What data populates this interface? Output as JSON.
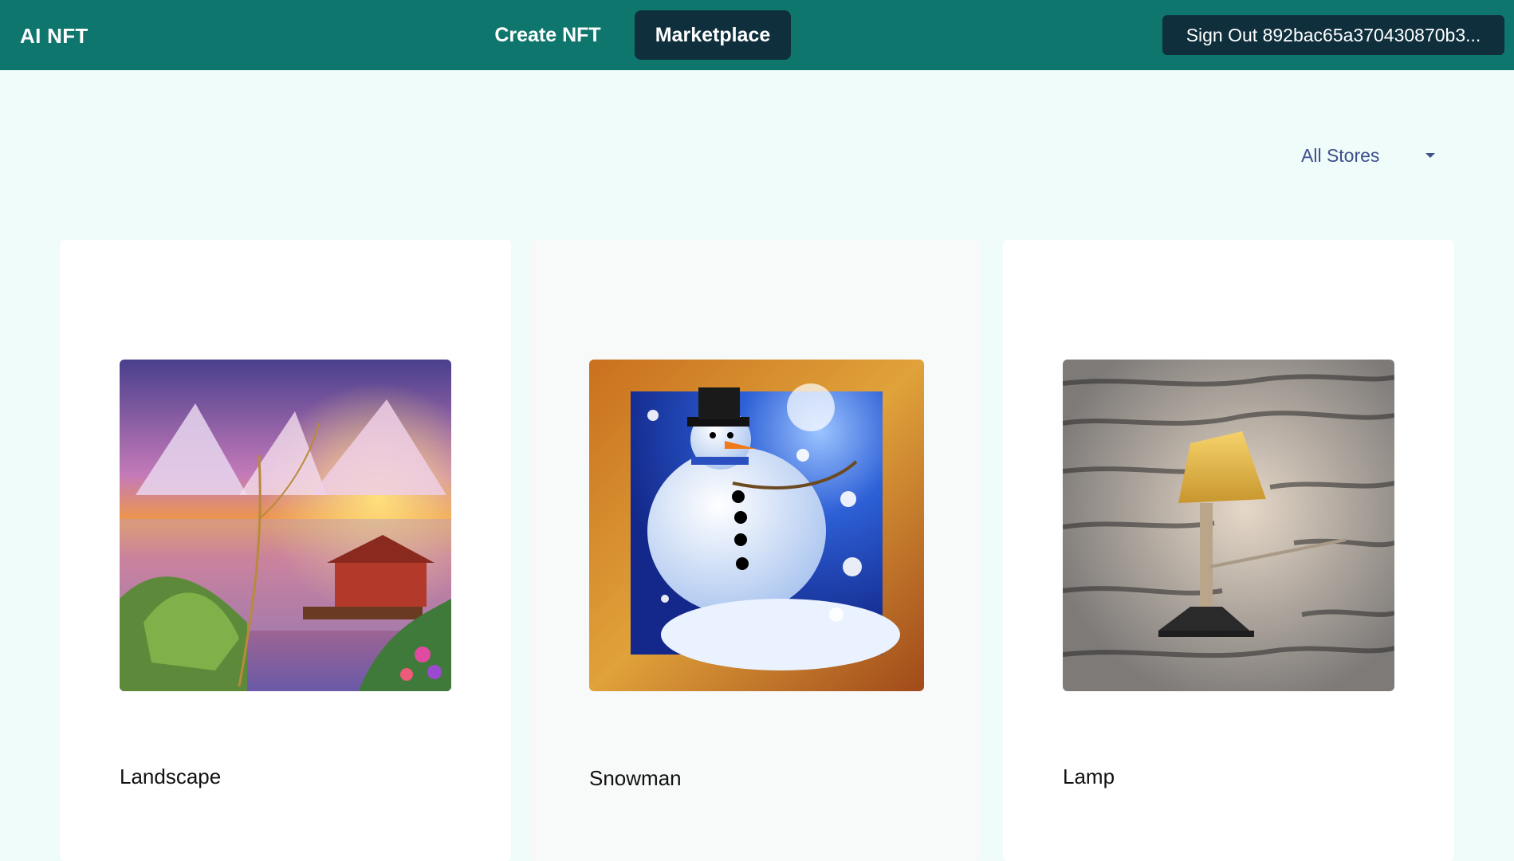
{
  "navbar": {
    "brand": "AI NFT",
    "links": [
      {
        "label": "Create NFT",
        "active": false
      },
      {
        "label": "Marketplace",
        "active": true
      }
    ],
    "signout_label": "Sign Out 892bac65a370430870b3..."
  },
  "filter": {
    "selected": "All Stores"
  },
  "cards": [
    {
      "title": "Landscape",
      "image": "landscape-painting"
    },
    {
      "title": "Snowman",
      "image": "snowman-painting"
    },
    {
      "title": "Lamp",
      "image": "lamp-photo"
    }
  ],
  "colors": {
    "navbar": "#0f766e",
    "active_button": "#0f2f3d",
    "page_background": "#effcf9",
    "select_text": "#3f4f8c"
  }
}
